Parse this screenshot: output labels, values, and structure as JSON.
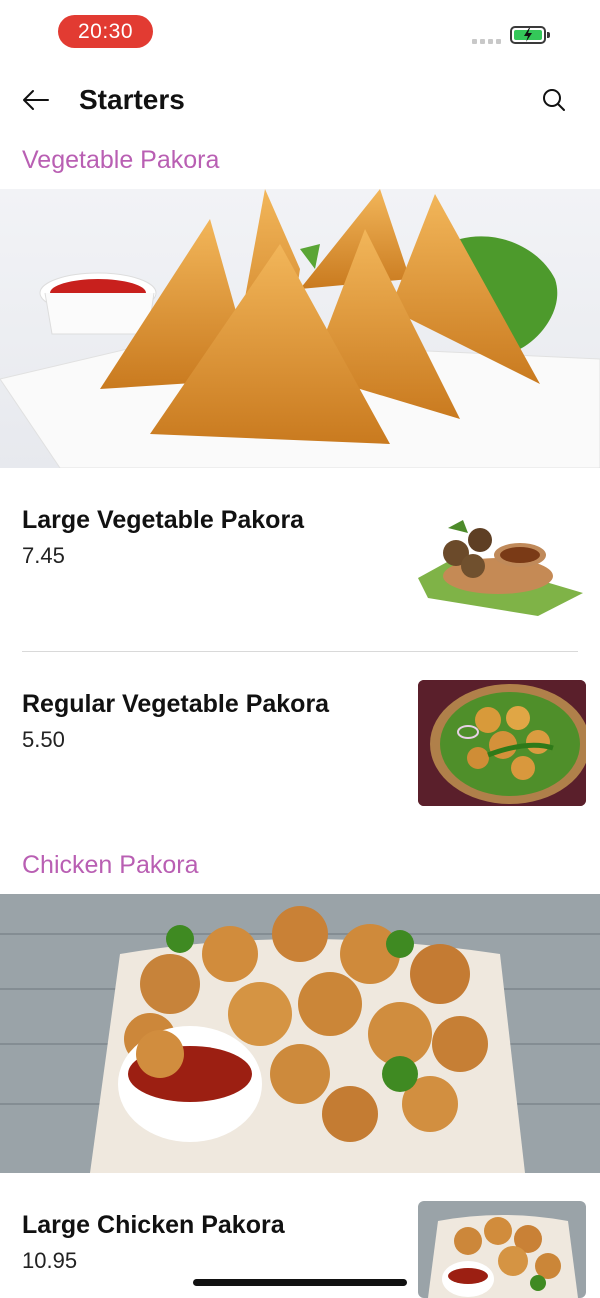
{
  "status": {
    "time": "20:30"
  },
  "header": {
    "title": "Starters",
    "back_icon": "arrow-left-icon",
    "search_icon": "search-icon"
  },
  "colors": {
    "section_title": "#b95fb3",
    "status_pill": "#e23b32",
    "battery": "#34c759"
  },
  "sections": [
    {
      "title": "Vegetable Pakora",
      "items": [
        {
          "name": "Large Vegetable Pakora",
          "price": "7.45"
        },
        {
          "name": "Regular Vegetable Pakora",
          "price": "5.50"
        }
      ]
    },
    {
      "title": "Chicken Pakora",
      "items": [
        {
          "name": "Large Chicken Pakora",
          "price": "10.95"
        }
      ]
    }
  ]
}
